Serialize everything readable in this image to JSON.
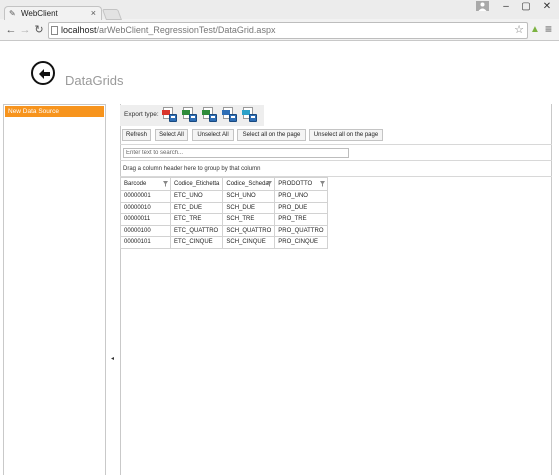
{
  "browser": {
    "tab_title": "WebClient",
    "url_host": "localhost",
    "url_path": "/arWebClient_RegressionTest/DataGrid.aspx",
    "window_controls": [
      "–",
      "▢",
      "✕"
    ]
  },
  "page": {
    "title": "DataGrids"
  },
  "sidebar": {
    "items": [
      {
        "label": "New Data Source",
        "selected": true
      }
    ],
    "collapse_arrow": "◂"
  },
  "export": {
    "label": "Export type:",
    "icons": [
      {
        "name": "pdf-export-icon",
        "color": "#d9342b"
      },
      {
        "name": "xls-export-icon",
        "color": "#2e8b3a"
      },
      {
        "name": "xlsx-export-icon",
        "color": "#2e8b3a"
      },
      {
        "name": "rtf-export-icon",
        "color": "#2d6db5"
      },
      {
        "name": "csv-export-icon",
        "color": "#2aa0c8"
      }
    ]
  },
  "toolbar": {
    "refresh": "Refresh",
    "select_all": "Select All",
    "unselect_all": "Unselect All",
    "select_page": "Select all on the page",
    "unselect_page": "Unselect all on the page"
  },
  "search": {
    "placeholder": "Enter text to search..."
  },
  "group_panel": {
    "text": "Drag a column header here to group by that column"
  },
  "grid": {
    "columns": [
      "Barcode",
      "Codice_Etichetta",
      "Codice_Scheda",
      "PRODOTTO"
    ],
    "rows": [
      [
        "00000001",
        "ETC_UNO",
        "SCH_UNO",
        "PRO_UNO"
      ],
      [
        "00000010",
        "ETC_DUE",
        "SCH_DUE",
        "PRO_DUE"
      ],
      [
        "00000011",
        "ETC_TRE",
        "SCH_TRE",
        "PRO_TRE"
      ],
      [
        "00000100",
        "ETC_QUATTRO",
        "SCH_QUATTRO",
        "PRO_QUATTRO"
      ],
      [
        "00000101",
        "ETC_CINQUE",
        "SCH_CINQUE",
        "PRO_CINQUE"
      ]
    ]
  },
  "colors": {
    "accent": "#f7941d",
    "title": "#9a9a9a",
    "border": "#c9c9c9"
  }
}
